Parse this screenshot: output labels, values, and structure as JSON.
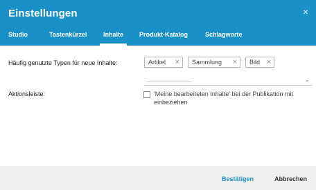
{
  "dialog": {
    "title": "Einstellungen",
    "close_glyph": "×"
  },
  "tabs": [
    {
      "label": "Studio"
    },
    {
      "label": "Tastenkürzel"
    },
    {
      "label": "Inhalte"
    },
    {
      "label": "Produkt-Katalog"
    },
    {
      "label": "Schlagworte"
    }
  ],
  "active_tab": "Inhalte",
  "content_types": {
    "label": "Häufig genutzte Typen für neue Inhalte:",
    "tags": [
      {
        "label": "Artikel"
      },
      {
        "label": "Sammlung"
      },
      {
        "label": "Bild"
      }
    ],
    "remove_glyph": "×",
    "chevron_glyph": "⌄"
  },
  "action_bar": {
    "label": "Aktionsleiste:",
    "checkbox_label": "'Meine bearbeiteten Inhalte' bei der Publikation mit einbeziehen",
    "checked": false
  },
  "footer": {
    "confirm_label": "Bestätigen",
    "cancel_label": "Abbrechen"
  },
  "colors": {
    "accent": "#1a91c6",
    "footer_bg": "#efefef"
  }
}
